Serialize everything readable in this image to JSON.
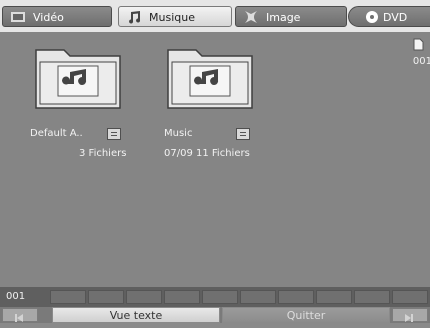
{
  "tabs": [
    {
      "label": "Vidéo",
      "icon": "video-icon"
    },
    {
      "label": "Musique",
      "icon": "music-note-icon"
    },
    {
      "label": "Image",
      "icon": "image-icon"
    },
    {
      "label": "DVD",
      "icon": "disc-icon"
    }
  ],
  "folders": [
    {
      "name": "Default A..",
      "info": "3 Fichiers"
    },
    {
      "name": "Music",
      "info": "07/09 11 Fichiers"
    }
  ],
  "side": {
    "number": "001"
  },
  "strip": {
    "page": "001"
  },
  "buttons": {
    "text_view": "Vue texte",
    "quit": "Quitter"
  }
}
